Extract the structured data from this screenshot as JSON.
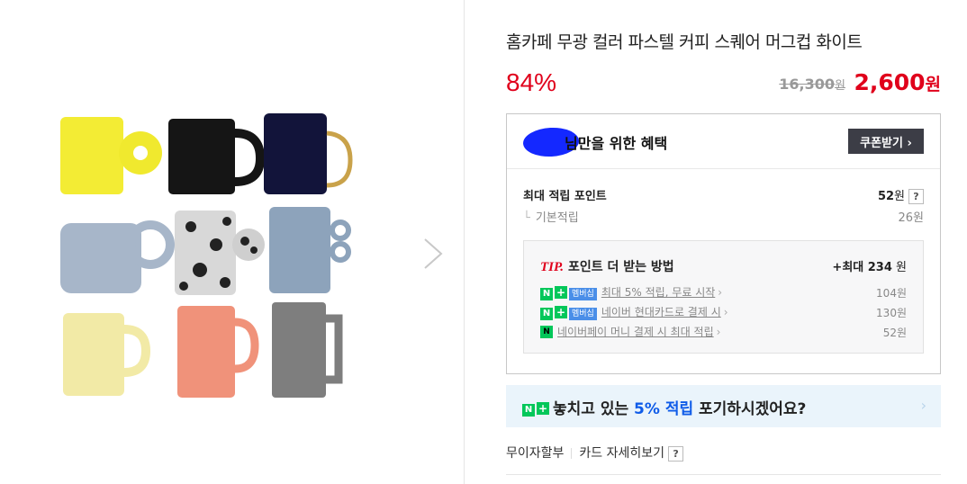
{
  "product": {
    "title": "홈카페 무광 컬러 파스텔 커피 스퀘어 머그컵 화이트",
    "discount": "84%",
    "original_price": "16,300",
    "original_unit": "원",
    "sale_price": "2,600",
    "sale_unit": "원"
  },
  "benefits": {
    "title": "님만을 위한 혜택",
    "coupon_button": "쿠폰받기 ›",
    "max_points_label": "최대 적립 포인트",
    "max_points_value": "52",
    "unit": "원",
    "help": "?",
    "basic_label": "기본적립",
    "basic_value": "26원"
  },
  "tip": {
    "label": "TIP.",
    "title": "포인트 더 받는 방법",
    "max_prefix": "+최대 ",
    "max_value": "234",
    "max_unit": " 원",
    "badge_n": "N",
    "badge_plus": "+",
    "badge_member": "멤버십",
    "badge_np": "N",
    "items": [
      {
        "text": "최대 5% 적립, 무료 시작",
        "value": "104원"
      },
      {
        "text": "네이버 현대카드로 결제 시",
        "value": "130원"
      },
      {
        "text": "네이버페이 머니 결제 시 최대 적립",
        "value": "52원"
      }
    ]
  },
  "promo": {
    "text_before": "놓치고 있는 ",
    "highlight": "5% 적립",
    "text_after": " 포기하시겠어요?",
    "chevron": "›"
  },
  "links": {
    "installment": "무이자할부",
    "card_detail": "카드 자세히보기",
    "help": "?"
  },
  "colors": {
    "accent_red": "#e0001b",
    "naver_green": "#03c75a",
    "highlight_blue": "#0e5be8",
    "dark_button": "#3c3d46"
  }
}
